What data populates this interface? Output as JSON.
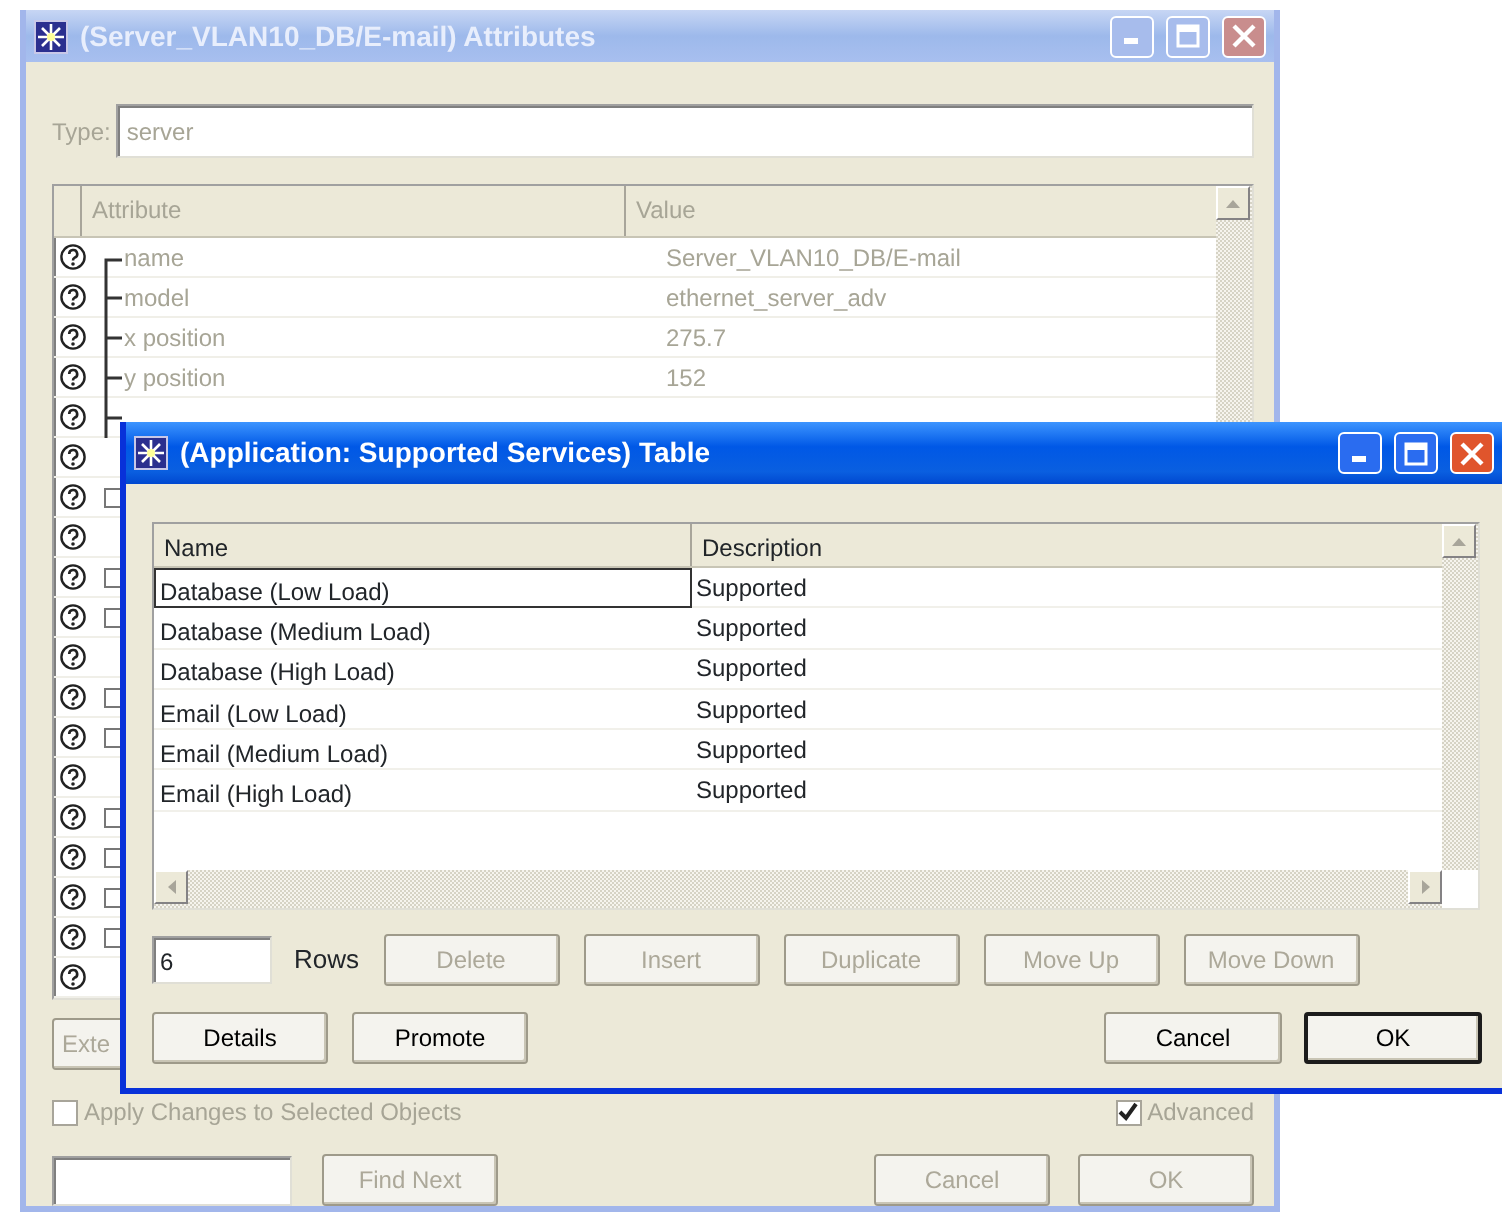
{
  "attributes_window": {
    "title": "(Server_VLAN10_DB/E-mail) Attributes",
    "active": false,
    "type_label": "Type:",
    "type_value": "server",
    "columns": [
      "Attribute",
      "Value"
    ],
    "rows": [
      {
        "name": "name",
        "value": "Server_VLAN10_DB/E-mail",
        "has_children": false
      },
      {
        "name": "model",
        "value": "ethernet_server_adv",
        "has_children": false
      },
      {
        "name": "x position",
        "value": "275.7",
        "has_children": false
      },
      {
        "name": "y position",
        "value": "152",
        "has_children": false
      },
      {
        "has_children": false
      },
      {
        "has_children": false
      },
      {
        "has_children": true
      },
      {
        "has_children": false
      },
      {
        "has_children": true
      },
      {
        "has_children": true
      },
      {
        "has_children": false
      },
      {
        "has_children": true
      },
      {
        "has_children": true
      },
      {
        "has_children": false
      },
      {
        "has_children": true
      },
      {
        "has_children": true
      },
      {
        "has_children": true
      },
      {
        "has_children": true
      },
      {
        "has_children": false
      }
    ],
    "extended_button": "Exte",
    "apply_changes": {
      "label": "Apply Changes to Selected Objects",
      "checked": false
    },
    "advanced": {
      "label": "Advanced",
      "checked": true
    },
    "left_buttons": [
      {
        "label": "Find Next",
        "disabled": true
      }
    ],
    "right_buttons": [
      {
        "label": "Cancel",
        "disabled": true
      },
      {
        "label": "OK",
        "disabled": true
      }
    ]
  },
  "table_window": {
    "title": "(Application: Supported Services) Table",
    "active": true,
    "columns": [
      "Name",
      "Description"
    ],
    "rows": [
      {
        "name": "Database (Low Load)",
        "description": "Supported",
        "focused": true
      },
      {
        "name": "Database (Medium Load)",
        "description": "Supported",
        "focused": false
      },
      {
        "name": "Database (High Load)",
        "description": "Supported",
        "focused": false
      },
      {
        "name": "Email (Low Load)",
        "description": "Supported",
        "focused": false
      },
      {
        "name": "Email (Medium Load)",
        "description": "Supported",
        "focused": false
      },
      {
        "name": "Email (High Load)",
        "description": "Supported",
        "focused": false
      }
    ],
    "row_count": "6",
    "row_count_label": "Rows",
    "row_buttons": [
      {
        "label": "Delete",
        "disabled": true
      },
      {
        "label": "Insert",
        "disabled": true
      },
      {
        "label": "Duplicate",
        "disabled": true
      },
      {
        "label": "Move Up",
        "disabled": true
      },
      {
        "label": "Move Down",
        "disabled": true
      }
    ],
    "left_buttons": [
      {
        "label": "Details",
        "disabled": false
      },
      {
        "label": "Promote",
        "disabled": false
      }
    ],
    "right_buttons": [
      {
        "label": "Cancel",
        "disabled": false
      },
      {
        "label": "OK",
        "disabled": false,
        "default": true
      }
    ]
  }
}
